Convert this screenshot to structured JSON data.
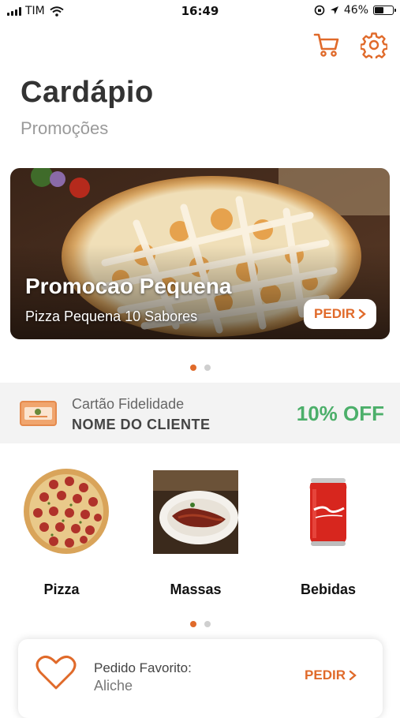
{
  "status_bar": {
    "carrier": "TIM",
    "time": "16:49",
    "battery": "46%"
  },
  "header": {
    "title": "Cardápio",
    "subtitle": "Promoções"
  },
  "banner": {
    "title": "Promocao Pequena",
    "subtitle": "Pizza Pequena 10 Sabores",
    "button_label": "PEDIR"
  },
  "banner_pager": {
    "count": 2,
    "active_index": 0
  },
  "loyalty": {
    "label": "Cartão Fidelidade",
    "customer_name": "NOME DO CLIENTE",
    "discount": "10% OFF"
  },
  "categories": [
    {
      "label": "Pizza"
    },
    {
      "label": "Massas"
    },
    {
      "label": "Bebidas"
    }
  ],
  "category_pager": {
    "count": 2,
    "active_index": 0
  },
  "favorite": {
    "label": "Pedido Favorito:",
    "value": "Aliche",
    "button_label": "PEDIR"
  },
  "colors": {
    "accent": "#e06a2a",
    "discount": "#4caf6a",
    "loyalty_bg": "#f3f3f3"
  }
}
